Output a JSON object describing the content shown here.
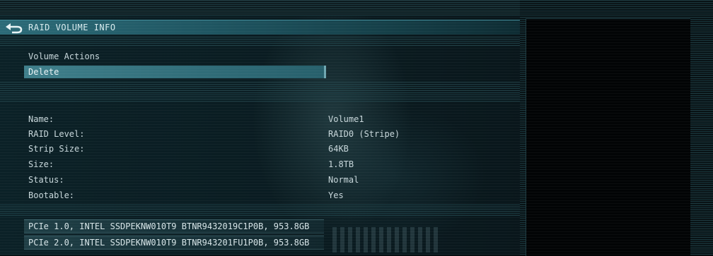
{
  "header": {
    "title": "RAID VOLUME INFO"
  },
  "actions": {
    "section_title": "Volume Actions",
    "delete_label": "Delete"
  },
  "volume": {
    "fields": [
      {
        "key": "Name:",
        "value": "Volume1"
      },
      {
        "key": "RAID Level:",
        "value": "RAID0 (Stripe)"
      },
      {
        "key": "Strip Size:",
        "value": "64KB"
      },
      {
        "key": "Size:",
        "value": "1.8TB"
      },
      {
        "key": "Status:",
        "value": "Normal"
      },
      {
        "key": "Bootable:",
        "value": "Yes"
      }
    ]
  },
  "disks": [
    "PCIe 1.0, INTEL SSDPEKNW010T9 BTNR9432019C1P0B, 953.8GB",
    "PCIe 2.0, INTEL SSDPEKNW010T9 BTNR943201FU1P0B, 953.8GB"
  ],
  "icons": {
    "back": "back-arrow-icon"
  },
  "colors": {
    "accent": "#2c6b78",
    "selected_row": "#3f7f8b",
    "text": "#c9d8dc",
    "background": "#0a1a1f"
  }
}
